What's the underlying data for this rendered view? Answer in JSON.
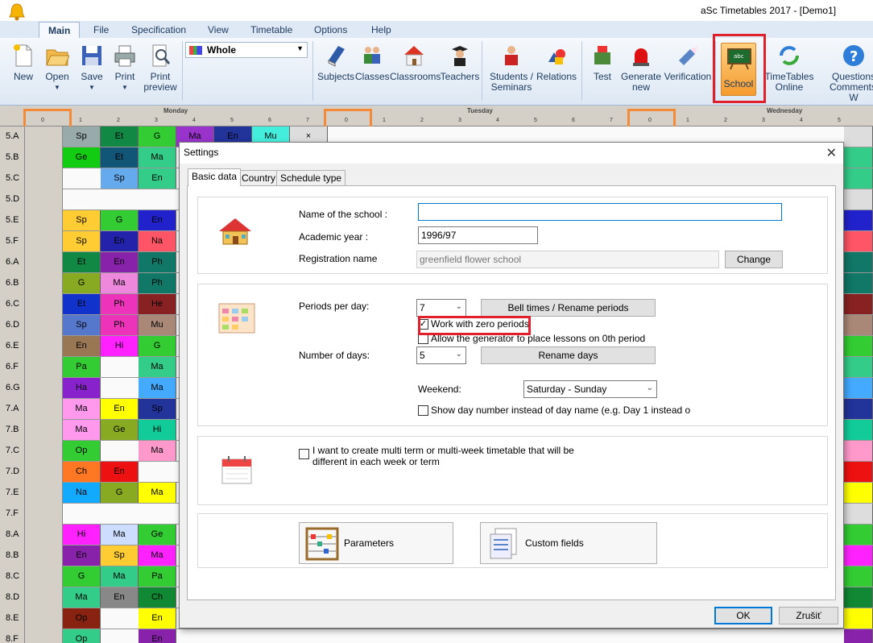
{
  "window": {
    "title": "aSc Timetables 2017  - [Demo1]"
  },
  "ribbon_tabs": [
    "Main",
    "File",
    "Specification",
    "View",
    "Timetable",
    "Options",
    "Help"
  ],
  "ribbon": {
    "new": "New",
    "open": "Open",
    "save": "Save",
    "print": "Print",
    "print_preview_1": "Print",
    "print_preview_2": "preview",
    "view_select": "Whole",
    "subjects": "Subjects",
    "classes": "Classes",
    "classrooms": "Classrooms",
    "teachers": "Teachers",
    "students_1": "Students /",
    "students_2": "Seminars",
    "relations": "Relations",
    "test": "Test",
    "generate_1": "Generate",
    "generate_2": "new",
    "verification": "Verification",
    "school": "School",
    "online_1": "TimeTables",
    "online_2": "Online",
    "questions_1": "Questions",
    "questions_2": "Comments? W"
  },
  "grid": {
    "days": [
      "Monday",
      "Tuesday",
      "Wednesday"
    ],
    "periods": [
      "0",
      "1",
      "2",
      "3",
      "4",
      "5",
      "6",
      "7"
    ],
    "rows": [
      {
        "label": "5.A",
        "cells": [
          [
            "Sp",
            "#9aa"
          ],
          [
            "Et",
            "#184"
          ],
          [
            "G",
            "#3c3"
          ],
          [
            "Ma",
            "#93c"
          ],
          [
            "En",
            "#239"
          ],
          [
            "Mu",
            "#4ed"
          ],
          [
            "×",
            "#ddd"
          ]
        ]
      },
      {
        "label": "5.B",
        "cells": [
          [
            "Ge",
            "#1c1"
          ],
          [
            "Et",
            "#157"
          ],
          [
            "Ma",
            "#3c8"
          ]
        ]
      },
      {
        "label": "5.C",
        "cells": [
          [
            "",
            ""
          ],
          [
            "Sp",
            "#6ae"
          ],
          [
            "En",
            "#3c8"
          ]
        ]
      },
      {
        "label": "5.D",
        "cells": []
      },
      {
        "label": "5.E",
        "cells": [
          [
            "Sp",
            "#fc3"
          ],
          [
            "G",
            "#3c3"
          ],
          [
            "En",
            "#22c"
          ]
        ]
      },
      {
        "label": "5.F",
        "cells": [
          [
            "Sp",
            "#fc3"
          ],
          [
            "En",
            "#22a"
          ],
          [
            "Na",
            "#f56"
          ]
        ]
      },
      {
        "label": "6.A",
        "cells": [
          [
            "Et",
            "#184"
          ],
          [
            "En",
            "#82a"
          ],
          [
            "Ph",
            "#176"
          ]
        ]
      },
      {
        "label": "6.B",
        "cells": [
          [
            "G",
            "#8a2"
          ],
          [
            "Ma",
            "#e8d"
          ],
          [
            "Ph",
            "#176"
          ]
        ]
      },
      {
        "label": "6.C",
        "cells": [
          [
            "Et",
            "#13c"
          ],
          [
            "Ph",
            "#e3b"
          ],
          [
            "He",
            "#822"
          ]
        ]
      },
      {
        "label": "6.D",
        "cells": [
          [
            "Sp",
            "#57c"
          ],
          [
            "Ph",
            "#e3b"
          ],
          [
            "Mu",
            "#a87"
          ]
        ]
      },
      {
        "label": "6.E",
        "cells": [
          [
            "En",
            "#975"
          ],
          [
            "Hi",
            "#f2f"
          ],
          [
            "G",
            "#3c3"
          ]
        ]
      },
      {
        "label": "6.F",
        "cells": [
          [
            "Pa",
            "#3c3"
          ],
          [
            "",
            ""
          ],
          [
            "Ma",
            "#3c8"
          ]
        ]
      },
      {
        "label": "6.G",
        "cells": [
          [
            "Ha",
            "#82c"
          ],
          [
            "",
            ""
          ],
          [
            "Ma",
            "#4af"
          ]
        ]
      },
      {
        "label": "7.A",
        "cells": [
          [
            "Ma",
            "#f9e"
          ],
          [
            "En",
            "#ff0"
          ],
          [
            "Sp",
            "#239"
          ]
        ]
      },
      {
        "label": "7.B",
        "cells": [
          [
            "Ma",
            "#f9e"
          ],
          [
            "Ge",
            "#8a2"
          ],
          [
            "Hi",
            "#1c9"
          ]
        ]
      },
      {
        "label": "7.C",
        "cells": [
          [
            "Op",
            "#3c3"
          ],
          [
            "",
            ""
          ],
          [
            "Ma",
            "#f9c"
          ]
        ]
      },
      {
        "label": "7.D",
        "cells": [
          [
            "Ch",
            "#f72"
          ],
          [
            "En",
            "#e11"
          ]
        ]
      },
      {
        "label": "7.E",
        "cells": [
          [
            "Na",
            "#1af"
          ],
          [
            "G",
            "#8a2"
          ],
          [
            "Ma",
            "#ff0"
          ]
        ]
      },
      {
        "label": "7.F",
        "cells": []
      },
      {
        "label": "8.A",
        "cells": [
          [
            "Hi",
            "#f2f"
          ],
          [
            "Ma",
            "#cdf"
          ],
          [
            "Ge",
            "#3c3"
          ]
        ]
      },
      {
        "label": "8.B",
        "cells": [
          [
            "En",
            "#82a"
          ],
          [
            "Sp",
            "#fc3"
          ],
          [
            "Ma",
            "#f2f"
          ]
        ]
      },
      {
        "label": "8.C",
        "cells": [
          [
            "G",
            "#3c3"
          ],
          [
            "Ma",
            "#3c8"
          ],
          [
            "Pa",
            "#3c3"
          ]
        ]
      },
      {
        "label": "8.D",
        "cells": [
          [
            "Ma",
            "#3c8"
          ],
          [
            "En",
            "#888"
          ],
          [
            "Ch",
            "#183"
          ]
        ]
      },
      {
        "label": "8.E",
        "cells": [
          [
            "Op",
            "#821"
          ],
          [
            "",
            ""
          ],
          [
            "En",
            "#ff0"
          ]
        ]
      },
      {
        "label": "8.F",
        "cells": [
          [
            "Op",
            "#3c8"
          ],
          [
            "",
            ""
          ],
          [
            "En",
            "#82a"
          ]
        ]
      }
    ]
  },
  "dialog": {
    "title": "Settings",
    "tabs": [
      "Basic data",
      "Country",
      "Schedule type"
    ],
    "school_name_label": "Name of the school :",
    "school_name_value": "",
    "academic_year_label": "Academic year :",
    "academic_year_value": "1996/97",
    "registration_label": "Registration name",
    "registration_value": "greenfield flower school",
    "change_button": "Change",
    "periods_label": "Periods per day:",
    "periods_value": "7",
    "bell_times_button": "Bell times / Rename periods",
    "zero_periods_label": "Work with zero periods",
    "zero_periods_checked": true,
    "allow_generator_label": "Allow the generator to place lessons on 0th period",
    "days_label": "Number of days:",
    "days_value": "5",
    "rename_days_button": "Rename days",
    "weekend_label": "Weekend:",
    "weekend_value": "Saturday - Sunday",
    "show_day_number_label": "Show day number instead of day name (e.g. Day 1 instead o",
    "multi_term_label_1": "I want to create multi term or multi-week timetable that will be",
    "multi_term_label_2": "different in each week or term",
    "parameters_button": "Parameters",
    "custom_fields_button": "Custom fields",
    "ok_button": "OK",
    "cancel_button": "Zrušiť"
  },
  "colors": {
    "highlight_red": "#e0202a",
    "highlight_orange": "#f28a3a",
    "accent_blue": "#0078d7"
  }
}
